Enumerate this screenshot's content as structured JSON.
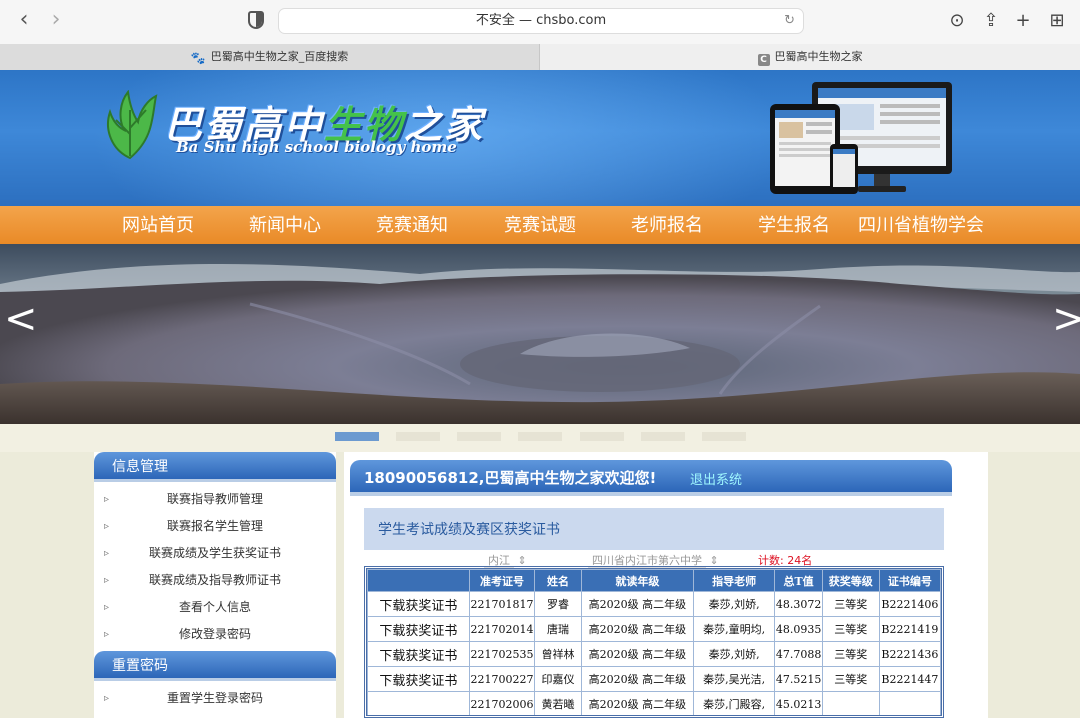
{
  "browser": {
    "url_text": "不安全 — chsbo.com",
    "tabs": [
      {
        "label": "巴蜀高中生物之家_百度搜索"
      },
      {
        "label": "巴蜀高中生物之家"
      }
    ]
  },
  "site": {
    "logo_title_a": "巴蜀高中",
    "logo_title_b": "生物",
    "logo_title_c": "之家",
    "logo_subtitle": "Ba Shu high school biology home",
    "menu": [
      "网站首页",
      "新闻中心",
      "竞赛通知",
      "竞赛试题",
      "老师报名",
      "学生报名",
      "四川省植物学会"
    ],
    "carousel_prev": "<",
    "carousel_next": ">"
  },
  "sidebar": {
    "sections": [
      {
        "title": "信息管理",
        "items": [
          "联赛指导教师管理",
          "联赛报名学生管理",
          "联赛成绩及学生获奖证书",
          "联赛成绩及指导教师证书",
          "查看个人信息",
          "修改登录密码"
        ]
      },
      {
        "title": "重置密码",
        "items": [
          "重置学生登录密码"
        ]
      }
    ]
  },
  "main": {
    "welcome": "18090056812,巴蜀高中生物之家欢迎您!",
    "logout": "退出系统",
    "section_title": "学生考试成绩及赛区获奖证书",
    "filter_region": "内江",
    "filter_school": "四川省内江市第六中学",
    "count_text": "计数: 24名",
    "table": {
      "headers": [
        "",
        "准考证号",
        "姓名",
        "就读年级",
        "指导老师",
        "总T值",
        "获奖等级",
        "证书编号"
      ],
      "rows": [
        [
          "下载获奖证书",
          "221701817",
          "罗睿",
          "高2020级 高二年级",
          "秦莎,刘娇,",
          "48.3072",
          "三等奖",
          "B2221406"
        ],
        [
          "下载获奖证书",
          "221702014",
          "唐瑞",
          "高2020级 高二年级",
          "秦莎,童明均,",
          "48.0935",
          "三等奖",
          "B2221419"
        ],
        [
          "下载获奖证书",
          "221702535",
          "曾祥林",
          "高2020级 高二年级",
          "秦莎,刘娇,",
          "47.7088",
          "三等奖",
          "B2221436"
        ],
        [
          "下载获奖证书",
          "221700227",
          "印嘉仪",
          "高2020级 高二年级",
          "秦莎,吴光洁,",
          "47.5215",
          "三等奖",
          "B2221447"
        ],
        [
          "",
          "221702006",
          "黄若曦",
          "高2020级 高二年级",
          "秦莎,门殿容,",
          "45.0213",
          "",
          ""
        ]
      ]
    }
  }
}
